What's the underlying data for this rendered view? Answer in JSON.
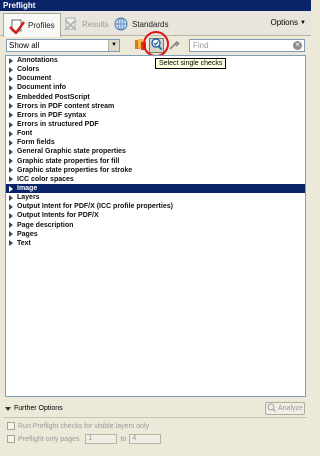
{
  "window": {
    "title": "Preflight"
  },
  "tabs": [
    {
      "label": "Profiles",
      "active": true,
      "icon": "profiles-icon"
    },
    {
      "label": "Results",
      "active": false,
      "icon": "results-icon"
    },
    {
      "label": "Standards",
      "active": false,
      "icon": "standards-icon"
    }
  ],
  "options_label": "Options",
  "toolbar": {
    "filter_value": "Show all",
    "search_placeholder": "Find",
    "tooltip": "Select single checks"
  },
  "list": {
    "items": [
      "Annotations",
      "Colors",
      "Document",
      "Document info",
      "Embedded PostScript",
      "Errors in PDF content stream",
      "Errors in PDF syntax",
      "Errors in structured PDF",
      "Font",
      "Form fields",
      "General Graphic state properties",
      "Graphic state properties for fill",
      "Graphic state properties for stroke",
      "ICC color spaces",
      "Image",
      "Layers",
      "Output Intent for PDF/X (ICC profile properties)",
      "Output Intents for PDF/X",
      "Page description",
      "Pages",
      "Text"
    ],
    "selected_index": 14
  },
  "footer": {
    "further_options": "Further Options",
    "analyze": "Analyze",
    "visible_layers_label": "Run Preflight checks for visible layers only",
    "only_pages_label": "Preflight only pages",
    "page_from": "1",
    "to_label": "to",
    "page_to": "4"
  },
  "colors": {
    "titlebar": "#0a246a",
    "selection": "#0a246a",
    "highlight_ring": "#e0121a"
  }
}
